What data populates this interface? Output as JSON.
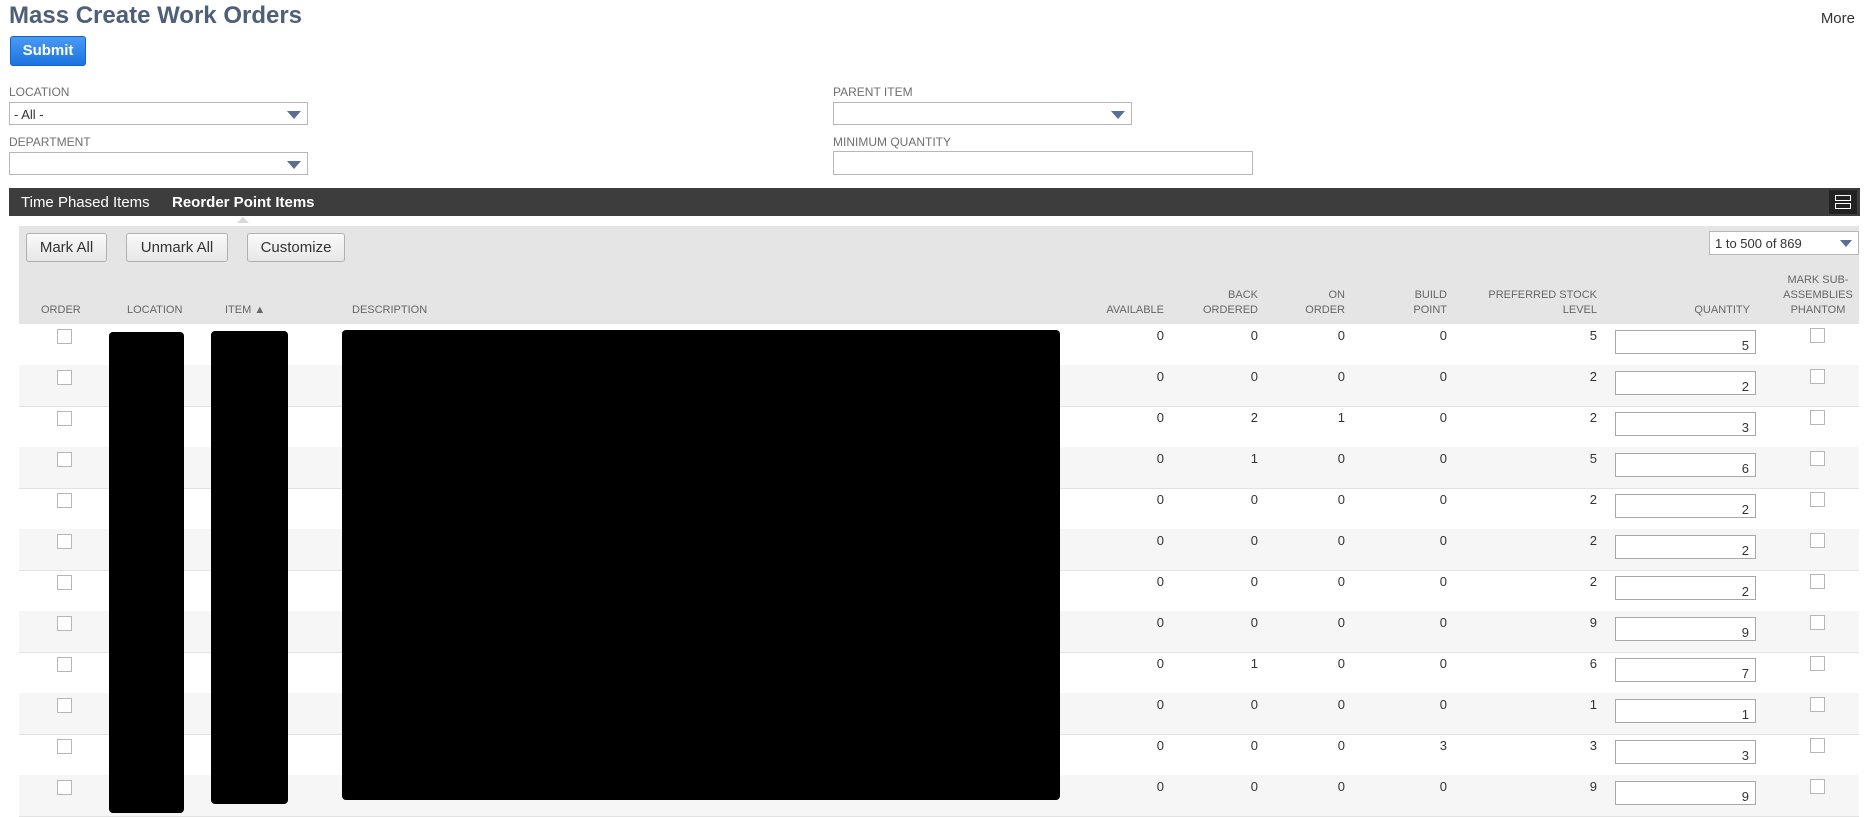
{
  "header": {
    "title": "Mass Create Work Orders",
    "more_label": "More",
    "submit_label": "Submit"
  },
  "filters": {
    "location": {
      "label": "LOCATION",
      "value": "- All -"
    },
    "department": {
      "label": "DEPARTMENT",
      "value": ""
    },
    "parent_item": {
      "label": "PARENT ITEM",
      "value": ""
    },
    "minimum_quantity": {
      "label": "MINIMUM QUANTITY",
      "value": ""
    }
  },
  "tabs": [
    {
      "label": "Time Phased Items",
      "active": false
    },
    {
      "label": "Reorder Point Items",
      "active": true
    }
  ],
  "toolbar": {
    "mark_all": "Mark All",
    "unmark_all": "Unmark All",
    "customize": "Customize",
    "pager": "1 to 500 of 869"
  },
  "columns": {
    "order": "ORDER",
    "location": "LOCATION",
    "item": "ITEM ▲",
    "description": "DESCRIPTION",
    "available": "AVAILABLE",
    "back_ordered": [
      "BACK",
      "ORDERED"
    ],
    "on_order": [
      "ON",
      "ORDER"
    ],
    "build_point": [
      "BUILD",
      "POINT"
    ],
    "preferred_stock": [
      "PREFERRED STOCK",
      "LEVEL"
    ],
    "quantity": "QUANTITY",
    "mark_sub": [
      "MARK SUB-",
      "ASSEMBLIES",
      "PHANTOM"
    ]
  },
  "rows": [
    {
      "available": "0",
      "back_ordered": "0",
      "on_order": "0",
      "build_point": "0",
      "preferred": "5",
      "quantity": "5"
    },
    {
      "available": "0",
      "back_ordered": "0",
      "on_order": "0",
      "build_point": "0",
      "preferred": "2",
      "quantity": "2"
    },
    {
      "available": "0",
      "back_ordered": "2",
      "on_order": "1",
      "build_point": "0",
      "preferred": "2",
      "quantity": "3"
    },
    {
      "available": "0",
      "back_ordered": "1",
      "on_order": "0",
      "build_point": "0",
      "preferred": "5",
      "quantity": "6"
    },
    {
      "available": "0",
      "back_ordered": "0",
      "on_order": "0",
      "build_point": "0",
      "preferred": "2",
      "quantity": "2"
    },
    {
      "available": "0",
      "back_ordered": "0",
      "on_order": "0",
      "build_point": "0",
      "preferred": "2",
      "quantity": "2"
    },
    {
      "available": "0",
      "back_ordered": "0",
      "on_order": "0",
      "build_point": "0",
      "preferred": "2",
      "quantity": "2"
    },
    {
      "available": "0",
      "back_ordered": "0",
      "on_order": "0",
      "build_point": "0",
      "preferred": "9",
      "quantity": "9"
    },
    {
      "available": "0",
      "back_ordered": "1",
      "on_order": "0",
      "build_point": "0",
      "preferred": "6",
      "quantity": "7"
    },
    {
      "available": "0",
      "back_ordered": "0",
      "on_order": "0",
      "build_point": "0",
      "preferred": "1",
      "quantity": "1"
    },
    {
      "available": "0",
      "back_ordered": "0",
      "on_order": "0",
      "build_point": "3",
      "preferred": "3",
      "quantity": "3"
    },
    {
      "available": "0",
      "back_ordered": "0",
      "on_order": "0",
      "build_point": "0",
      "preferred": "9",
      "quantity": "9"
    }
  ]
}
